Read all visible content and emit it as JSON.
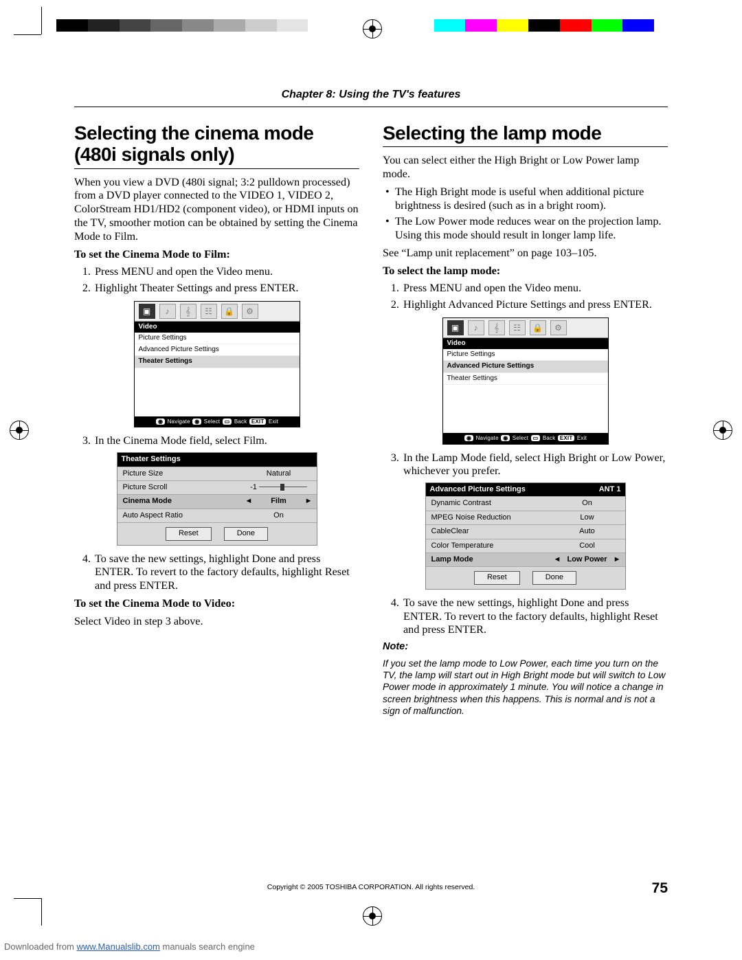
{
  "chapter": "Chapter 8: Using the TV's features",
  "left": {
    "heading": "Selecting the cinema mode (480i signals only)",
    "intro": "When you view a DVD (480i signal; 3:2 pulldown processed) from a DVD player connected to the VIDEO 1, VIDEO 2, ColorStream HD1/HD2 (component video), or HDMI inputs on the TV, smoother motion can be obtained by setting the Cinema Mode to Film.",
    "sub1": "To set the Cinema Mode to Film:",
    "step1": "Press MENU and open the Video menu.",
    "step2": "Highlight Theater Settings and press ENTER.",
    "osd1": {
      "section": "Video",
      "items": [
        "Picture Settings",
        "Advanced Picture Settings",
        "Theater Settings"
      ],
      "highlight_index": 2,
      "nav": "Navigate   Select   Back   Exit"
    },
    "step3": "In the Cinema Mode field, select Film.",
    "table1": {
      "title": "Theater Settings",
      "rows": [
        {
          "k": "Picture Size",
          "v": "Natural"
        },
        {
          "k": "Picture Scroll",
          "v": "-1",
          "slider": true
        },
        {
          "k": "Cinema Mode",
          "v": "Film",
          "hl": true,
          "arrows": true
        },
        {
          "k": "Auto Aspect Ratio",
          "v": "On"
        }
      ],
      "btn_reset": "Reset",
      "btn_done": "Done"
    },
    "step4": "To save the new settings, highlight Done and press ENTER. To revert to the factory defaults, highlight Reset and press ENTER.",
    "sub2": "To set the Cinema Mode to Video:",
    "p2": "Select Video in step 3 above."
  },
  "right": {
    "heading": "Selecting the lamp mode",
    "intro": "You can select either the High Bright or Low Power lamp mode.",
    "bullet1": "The High Bright mode is useful when additional picture brightness is desired (such as in a bright room).",
    "bullet2": "The Low Power mode reduces wear on the projection lamp. Using this mode should result in longer lamp life.",
    "see": "See “Lamp unit replacement” on page 103–105.",
    "sub1": "To select the lamp mode:",
    "step1": "Press MENU and open the Video menu.",
    "step2": "Highlight Advanced Picture Settings and press ENTER.",
    "osd2": {
      "section": "Video",
      "items": [
        "Picture Settings",
        "Advanced Picture Settings",
        "Theater Settings"
      ],
      "highlight_index": 1,
      "nav": "Navigate   Select   Back   Exit"
    },
    "step3": "In the Lamp Mode field, select High Bright or Low Power, whichever you prefer.",
    "table2": {
      "title": "Advanced Picture Settings",
      "title_right": "ANT 1",
      "rows": [
        {
          "k": "Dynamic Contrast",
          "v": "On"
        },
        {
          "k": "MPEG Noise Reduction",
          "v": "Low"
        },
        {
          "k": "CableClear",
          "v": "Auto"
        },
        {
          "k": "Color Temperature",
          "v": "Cool"
        },
        {
          "k": "Lamp Mode",
          "v": "Low Power",
          "hl": true,
          "arrows": true
        }
      ],
      "btn_reset": "Reset",
      "btn_done": "Done"
    },
    "step4": "To save the new settings, highlight Done and press ENTER. To revert to the factory defaults, highlight Reset and press ENTER.",
    "note_label": "Note:",
    "note_body": "If you set the lamp mode to Low Power, each time you turn on the TV, the lamp will start out in High Bright mode but will switch to Low Power mode in approximately 1 minute. You will notice a change in screen brightness when this happens. This is normal and is not a sign of malfunction."
  },
  "copyright": "Copyright © 2005 TOSHIBA CORPORATION. All rights reserved.",
  "page_number": "75",
  "footer": {
    "prefix": "Downloaded from ",
    "link": "www.Manualslib.com",
    "suffix": "  manuals search engine"
  },
  "colorbar": [
    "#000",
    "#222",
    "#444",
    "#666",
    "#888",
    "#aaa",
    "#ccc",
    "#e4e4e4",
    "#fff",
    "#fff",
    "#fff",
    "#fff",
    "#0ff",
    "#f0f",
    "#ff0",
    "#000",
    "#f00",
    "#0f0",
    "#00f",
    "#fff"
  ]
}
